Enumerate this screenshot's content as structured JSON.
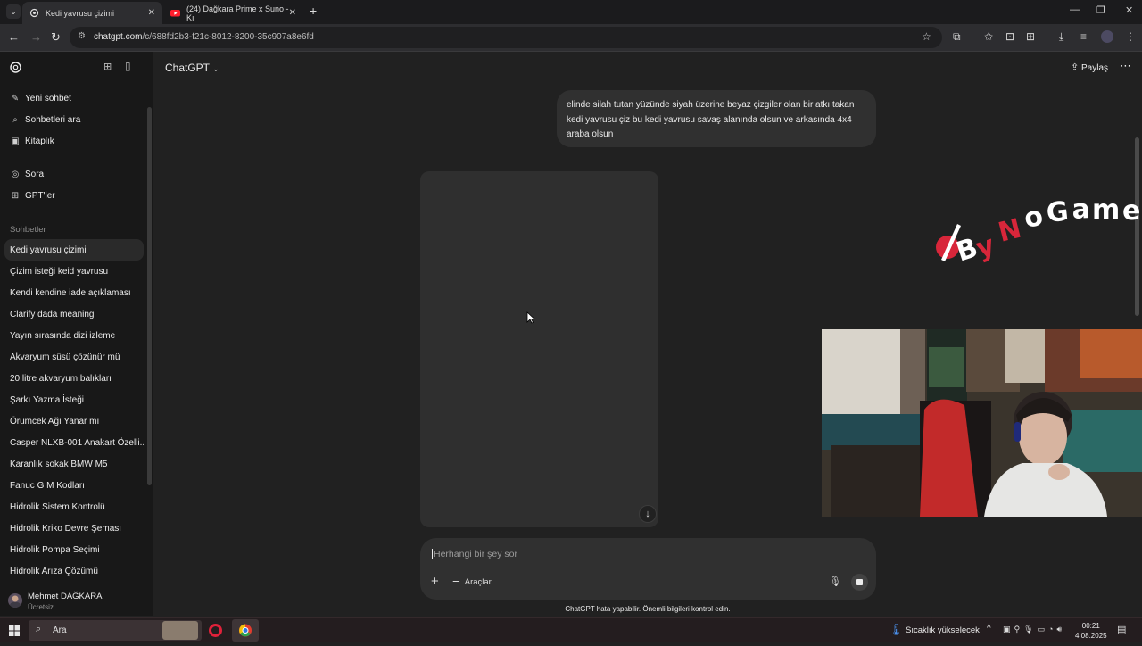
{
  "browser": {
    "tabs": [
      {
        "title": "Kedi yavrusu çizimi",
        "active": true
      },
      {
        "title": "(24) Dağkara Prime x Suno - Kı",
        "active": false
      }
    ],
    "url_host": "chatgpt.com",
    "url_path": "/c/688fd2b3-f21c-8012-8200-35c907a8e6fd"
  },
  "sidebar": {
    "top_items": [
      {
        "label": "Yeni sohbet",
        "icon": "edit-icon"
      },
      {
        "label": "Sohbetleri ara",
        "icon": "search-icon"
      },
      {
        "label": "Kitaplık",
        "icon": "library-icon"
      }
    ],
    "mid_items": [
      {
        "label": "Sora",
        "icon": "sora-icon"
      },
      {
        "label": "GPT'ler",
        "icon": "grid-icon"
      }
    ],
    "section_title": "Sohbetler",
    "chats": [
      "Kedi yavrusu çizimi",
      "Çizim isteği keid yavrusu",
      "Kendi kendine iade açıklaması",
      "Clarify dada meaning",
      "Yayın sırasında dizi izleme",
      "Akvaryum süsü çözünür mü",
      "20 litre akvaryum balıkları",
      "Şarkı Yazma İsteği",
      "Örümcek Ağı Yanar mı",
      "Casper NLXB-001 Anakart Özelli...",
      "Karanlık sokak BMW M5",
      "Fanuc G M Kodları",
      "Hidrolik Sistem Kontrolü",
      "Hidrolik Kriko Devre Şeması",
      "Hidrolik Pompa Seçimi",
      "Hidrolik Arıza Çözümü"
    ],
    "user": {
      "name": "Mehmet DAĞKARA",
      "plan": "Ücretsiz"
    }
  },
  "header": {
    "model": "ChatGPT",
    "share": "Paylaş"
  },
  "conversation": {
    "user_message": "elinde silah tutan yüzünde siyah üzerine beyaz çizgiler olan bir atkı takan kedi yavrusu çiz bu kedi yavrusu savaş alanında olsun ve arkasında 4x4 araba olsun"
  },
  "composer": {
    "placeholder": "Herhangi bir şey sor",
    "tools_label": "Araçlar"
  },
  "disclaimer": "ChatGPT hata yapabilir. Önemli bilgileri kontrol edin.",
  "overlay": {
    "watermark": "ByNoGame"
  },
  "taskbar": {
    "search": "Ara",
    "weather": "Sıcaklık yükselecek",
    "time": "00:21",
    "date": "4.08.2025"
  },
  "colors": {
    "sidebar_bg": "#181818",
    "main_bg": "#212121",
    "bubble_bg": "#303030",
    "watermark_red": "#d8263a"
  }
}
